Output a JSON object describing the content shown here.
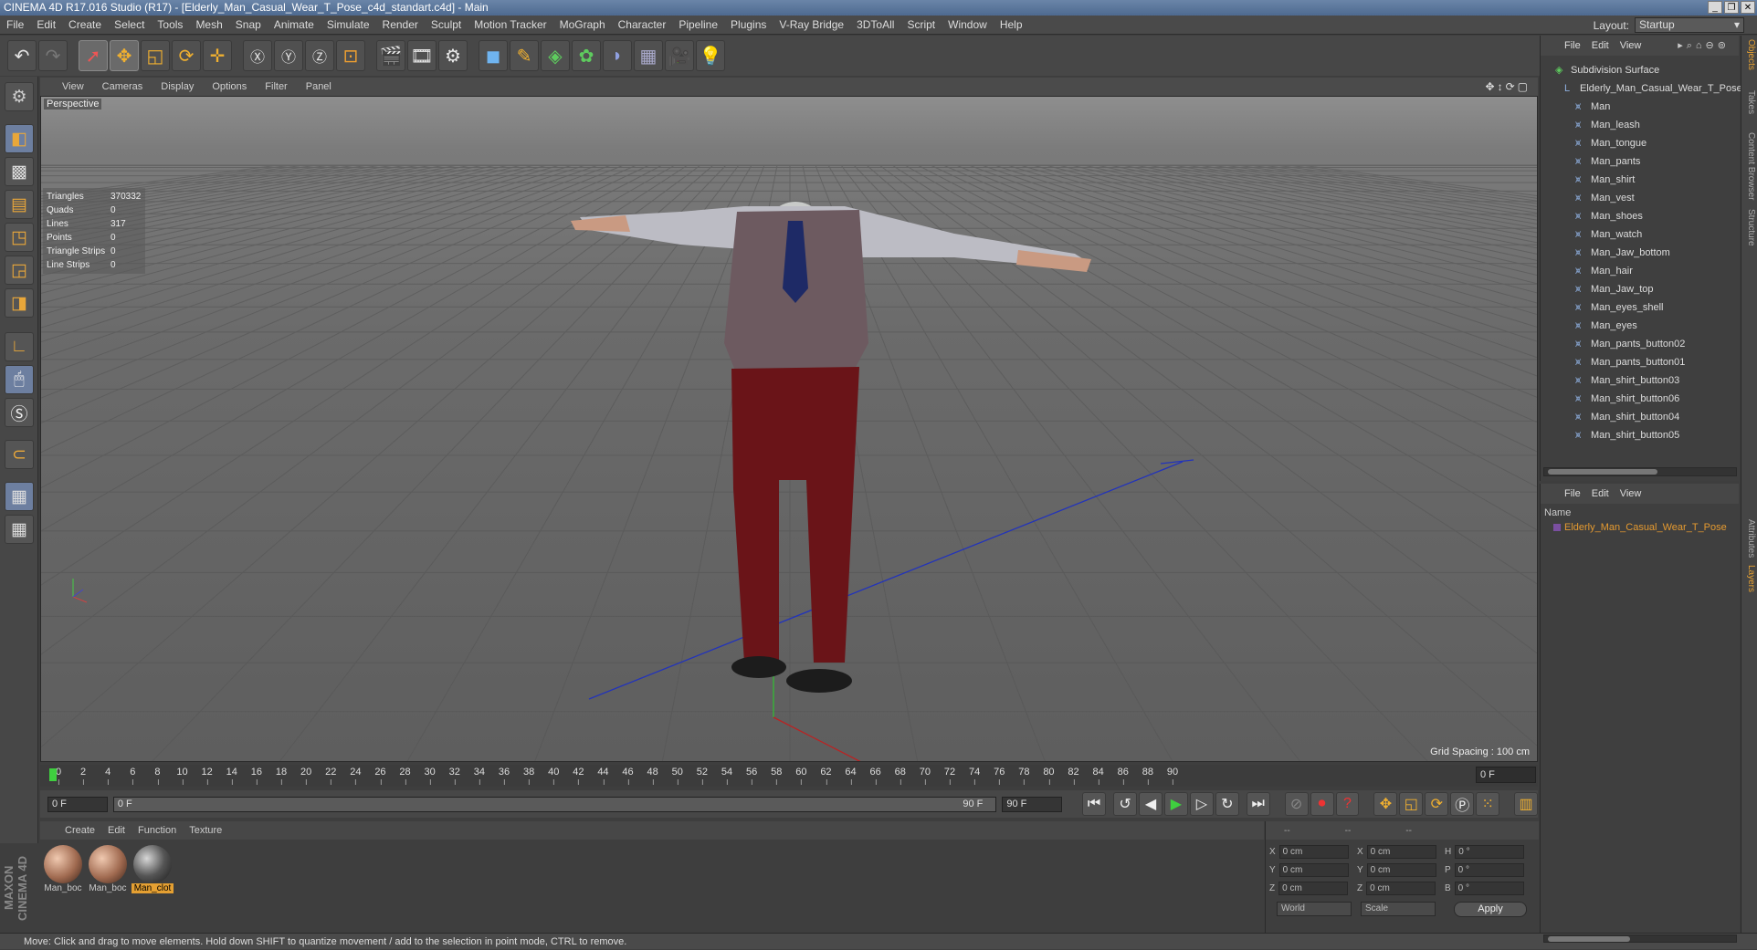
{
  "window": {
    "title": "CINEMA 4D R17.016 Studio (R17) - [Elderly_Man_Casual_Wear_T_Pose_c4d_standart.c4d] - Main"
  },
  "menu": [
    "File",
    "Edit",
    "Create",
    "Select",
    "Tools",
    "Mesh",
    "Snap",
    "Animate",
    "Simulate",
    "Render",
    "Sculpt",
    "Motion Tracker",
    "MoGraph",
    "Character",
    "Pipeline",
    "Plugins",
    "V-Ray Bridge",
    "3DToAll",
    "Script",
    "Window",
    "Help"
  ],
  "layout": {
    "label": "Layout:",
    "value": "Startup"
  },
  "viewport": {
    "menu": [
      "View",
      "Cameras",
      "Display",
      "Options",
      "Filter",
      "Panel"
    ],
    "label": "Perspective",
    "grid_spacing": "Grid Spacing : 100 cm",
    "stats": [
      {
        "k": "Triangles",
        "v": "370332"
      },
      {
        "k": "Quads",
        "v": "0"
      },
      {
        "k": "Lines",
        "v": "317"
      },
      {
        "k": "Points",
        "v": "0"
      },
      {
        "k": "Triangle Strips",
        "v": "0"
      },
      {
        "k": "Line Strips",
        "v": "0"
      }
    ]
  },
  "timeline": {
    "ticks": [
      "0",
      "2",
      "4",
      "6",
      "8",
      "10",
      "12",
      "14",
      "16",
      "18",
      "20",
      "22",
      "24",
      "26",
      "28",
      "30",
      "32",
      "34",
      "36",
      "38",
      "40",
      "42",
      "44",
      "46",
      "48",
      "50",
      "52",
      "54",
      "56",
      "58",
      "60",
      "62",
      "64",
      "66",
      "68",
      "70",
      "72",
      "74",
      "76",
      "78",
      "80",
      "82",
      "84",
      "86",
      "88",
      "90"
    ],
    "current_frame": "0 F",
    "start": "0 F",
    "range_start": "0 F",
    "range_end": "90 F",
    "end": "90 F"
  },
  "materials": {
    "menu": [
      "Create",
      "Edit",
      "Function",
      "Texture"
    ],
    "items": [
      {
        "label": "Man_boc"
      },
      {
        "label": "Man_boc"
      },
      {
        "label": "Man_clot"
      }
    ]
  },
  "coords": {
    "header": [
      "--",
      "--",
      "--"
    ],
    "rows": [
      {
        "a": "X",
        "av": "0 cm",
        "b": "X",
        "bv": "0 cm",
        "c": "H",
        "cv": "0 °"
      },
      {
        "a": "Y",
        "av": "0 cm",
        "b": "Y",
        "bv": "0 cm",
        "c": "P",
        "cv": "0 °"
      },
      {
        "a": "Z",
        "av": "0 cm",
        "b": "Z",
        "bv": "0 cm",
        "c": "B",
        "cv": "0 °"
      }
    ],
    "world": "World",
    "scale": "Scale",
    "apply": "Apply"
  },
  "status": "Move: Click and drag to move elements. Hold down SHIFT to quantize movement / add to the selection in point mode, CTRL to remove.",
  "logo": "MAXON CINEMA 4D",
  "objects": {
    "menu": [
      "File",
      "Edit",
      "View"
    ],
    "root": "Subdivision Surface",
    "group": "Elderly_Man_Casual_Wear_T_Pose",
    "items": [
      "Man",
      "Man_leash",
      "Man_tongue",
      "Man_pants",
      "Man_shirt",
      "Man_vest",
      "Man_shoes",
      "Man_watch",
      "Man_Jaw_bottom",
      "Man_hair",
      "Man_Jaw_top",
      "Man_eyes_shell",
      "Man_eyes",
      "Man_pants_button02",
      "Man_pants_button01",
      "Man_shirt_button03",
      "Man_shirt_button06",
      "Man_shirt_button04",
      "Man_shirt_button05"
    ]
  },
  "layers": {
    "menu": [
      "File",
      "Edit",
      "View"
    ],
    "col": "Name",
    "row": "Elderly_Man_Casual_Wear_T_Pose"
  },
  "sidetabs": [
    "Objects",
    "Takes",
    "Content Browser",
    "Structure",
    "Attributes",
    "Layers"
  ]
}
